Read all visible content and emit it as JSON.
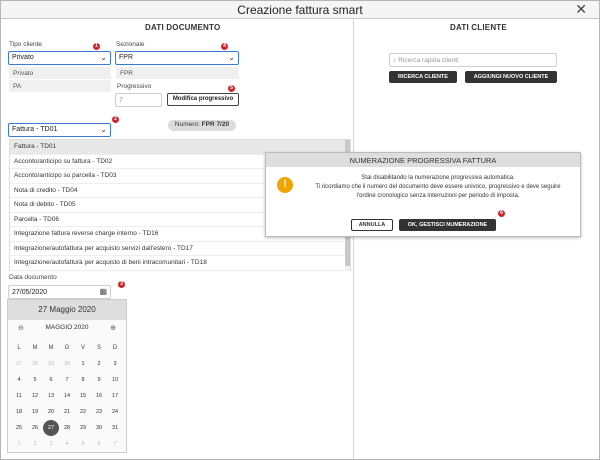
{
  "window": {
    "title": "Creazione fattura smart",
    "close_icon": "close-icon"
  },
  "left": {
    "section_title": "DATI DOCUMENTO",
    "tipo_cliente": {
      "label": "Tipo cliente",
      "value": "Privato",
      "options": [
        "Privato",
        "PA"
      ]
    },
    "sezionale": {
      "label": "Sezionale",
      "value": "FPR",
      "options": [
        "FPR"
      ]
    },
    "progressivo": {
      "label": "Progressivo",
      "value": "7",
      "button": "Modifica progressivo"
    },
    "numero": {
      "label": "Numero:",
      "value": "FPR 7/20"
    },
    "tipo_documento": {
      "value": "Fattura - TD01",
      "options": [
        "Fattura - TD01",
        "Acconto/anticipo su fattura - TD02",
        "Acconto/anticipo su parcella - TD03",
        "Nota di credito - TD04",
        "Nota di debito - TD05",
        "Parcella - TD06",
        "Integrazione fattura reverse charge interno - TD16",
        "Integrazione/autofattura per acquisto servizi dall'estero - TD17",
        "Integrazione/autofattura per acquisto di beni intracomunitari - TD18"
      ]
    },
    "data_documento": {
      "label": "Data documento",
      "value": "27/05/2020"
    },
    "calendar": {
      "header": "27 Maggio 2020",
      "month": "MAGGIO 2020",
      "dow": [
        "L",
        "M",
        "M",
        "G",
        "V",
        "S",
        "D"
      ],
      "weeks": [
        [
          "27",
          "28",
          "29",
          "30",
          "1",
          "2",
          "3"
        ],
        [
          "4",
          "5",
          "6",
          "7",
          "8",
          "9",
          "10"
        ],
        [
          "11",
          "12",
          "13",
          "14",
          "15",
          "16",
          "17"
        ],
        [
          "18",
          "19",
          "20",
          "21",
          "22",
          "23",
          "24"
        ],
        [
          "25",
          "26",
          "27",
          "28",
          "29",
          "30",
          "31"
        ],
        [
          "1",
          "2",
          "3",
          "4",
          "5",
          "6",
          "7"
        ]
      ],
      "selected": "27"
    },
    "markers": [
      "1",
      "2",
      "3",
      "4",
      "5",
      "6"
    ]
  },
  "right": {
    "section_title": "DATI CLIENTE",
    "search_placeholder": "Ricerca rapida clienti",
    "btn_search": "RICERCA CLIENTE",
    "btn_add": "AGGIUNGI NUOVO CLIENTE"
  },
  "modal": {
    "title": "NUMERAZIONE PROGRESSIVA FATTURA",
    "line1": "Stai disabilitando la numerazione progressiva automatica.",
    "line2": "Ti ricordiamo che il numero del documento deve essere univoco, progressivo e deve seguire",
    "line3": "l'ordine cronologico senza interruzioni per periodo di imposta.",
    "cancel": "ANNULLA",
    "confirm": "OK, GESTISCI NUMERAZIONE"
  },
  "colors": {
    "accent": "#3a7bd5",
    "marker": "#d2232a",
    "warning": "#f0a500",
    "dark_button": "#333333"
  }
}
